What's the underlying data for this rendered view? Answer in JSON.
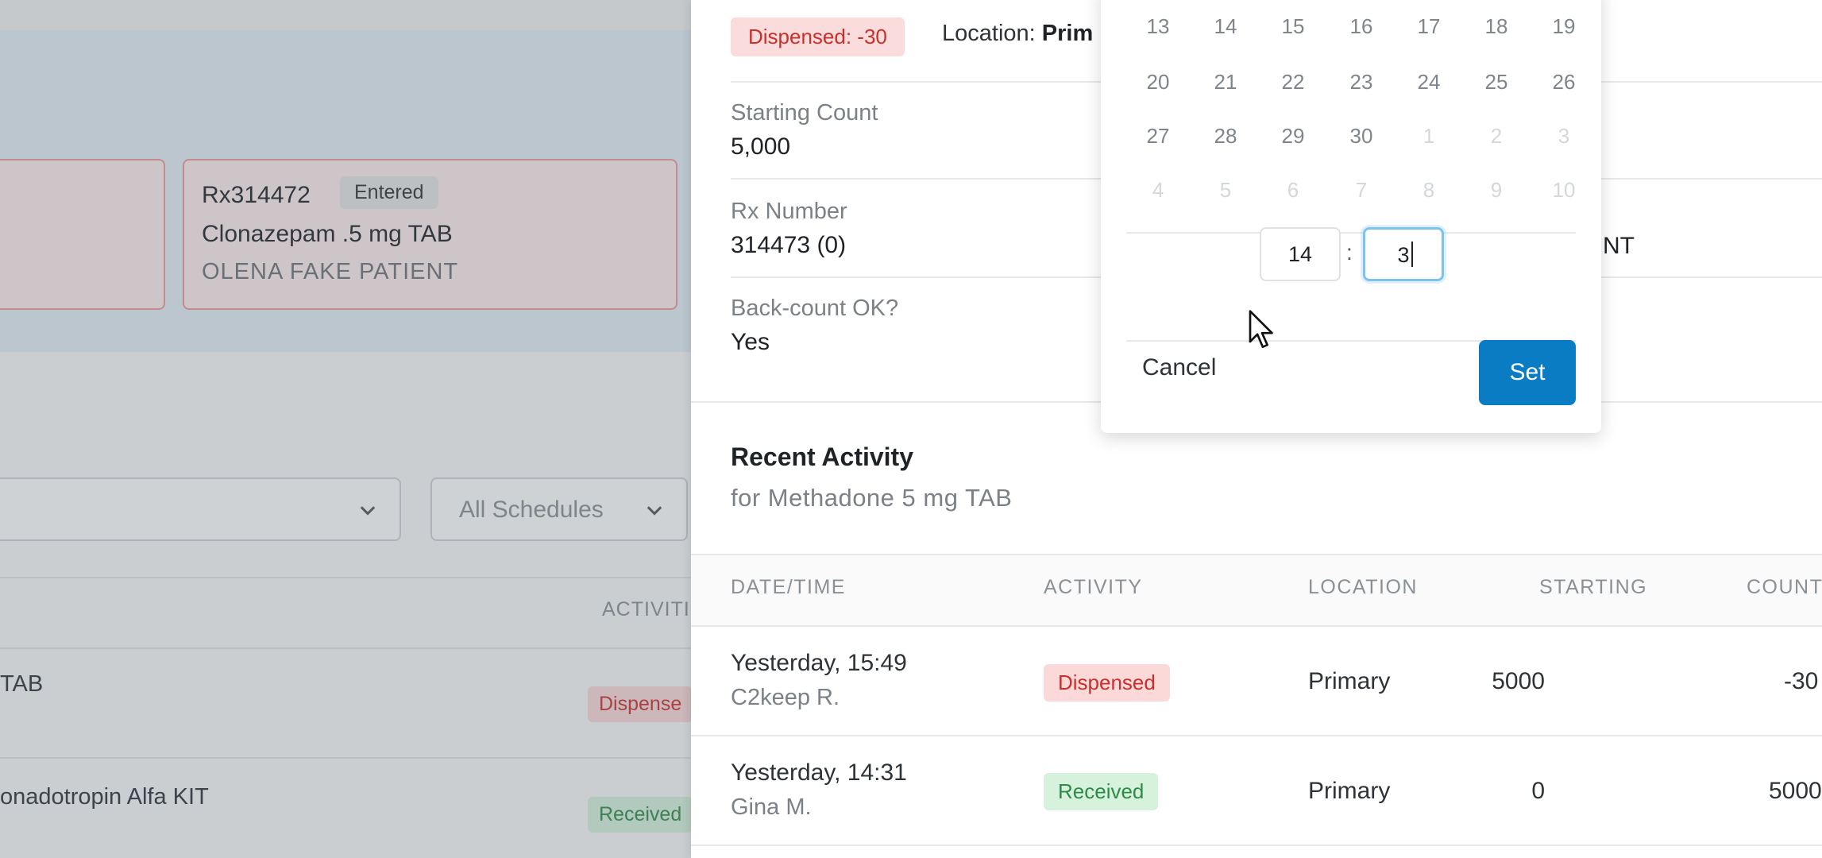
{
  "background": {
    "cards": [
      {
        "rx_number": "",
        "status": "",
        "drug": "",
        "patient": ""
      },
      {
        "rx_number": "Rx314472",
        "status": "Entered",
        "drug": "Clonazepam .5 mg TAB",
        "patient": "OLENA FAKE PATIENT"
      }
    ],
    "filters": {
      "left_select": "",
      "schedules_select": "All Schedules",
      "chevron_icon": "chevron-down-icon"
    },
    "table": {
      "activity_header": "ACTIVITI",
      "rows": [
        {
          "drug": "TAB",
          "activity": "Dispense"
        },
        {
          "drug": "onadotropin Alfa KIT",
          "activity": "Received"
        }
      ]
    }
  },
  "drawer": {
    "dispensed_chip": "Dispensed: -30",
    "location_label": "Location:",
    "location_value": "Prim",
    "fields": {
      "starting_count_label": "Starting Count",
      "starting_count_value": "5,000",
      "rx_number_label": "Rx Number",
      "rx_number_value": "314473 (0)",
      "patient_tail": "NT",
      "backcount_label": "Back-count OK?",
      "backcount_value": "Yes"
    },
    "recent_activity": {
      "title": "Recent Activity",
      "subtitle": "for Methadone 5 mg TAB",
      "columns": [
        "DATE/TIME",
        "ACTIVITY",
        "LOCATION",
        "STARTING",
        "COUNT"
      ],
      "rows": [
        {
          "datetime": "Yesterday, 15:49",
          "user": "C2keep R.",
          "activity": "Dispensed",
          "location": "Primary",
          "starting": "5000",
          "count": "-30"
        },
        {
          "datetime": "Yesterday, 14:31",
          "user": "Gina M.",
          "activity": "Received",
          "location": "Primary",
          "starting": "0",
          "count": "5000"
        }
      ]
    }
  },
  "picker": {
    "weeks": [
      [
        {
          "d": "13",
          "m": false
        },
        {
          "d": "14",
          "m": false
        },
        {
          "d": "15",
          "m": false
        },
        {
          "d": "16",
          "m": false
        },
        {
          "d": "17",
          "m": false
        },
        {
          "d": "18",
          "m": false
        },
        {
          "d": "19",
          "m": false
        }
      ],
      [
        {
          "d": "20",
          "m": false
        },
        {
          "d": "21",
          "m": false
        },
        {
          "d": "22",
          "m": false
        },
        {
          "d": "23",
          "m": false
        },
        {
          "d": "24",
          "m": false
        },
        {
          "d": "25",
          "m": false
        },
        {
          "d": "26",
          "m": false
        }
      ],
      [
        {
          "d": "27",
          "m": false
        },
        {
          "d": "28",
          "m": false
        },
        {
          "d": "29",
          "m": false
        },
        {
          "d": "30",
          "m": false
        },
        {
          "d": "1",
          "m": true
        },
        {
          "d": "2",
          "m": true
        },
        {
          "d": "3",
          "m": true
        }
      ],
      [
        {
          "d": "4",
          "m": true
        },
        {
          "d": "5",
          "m": true
        },
        {
          "d": "6",
          "m": true
        },
        {
          "d": "7",
          "m": true
        },
        {
          "d": "8",
          "m": true
        },
        {
          "d": "9",
          "m": true
        },
        {
          "d": "10",
          "m": true
        }
      ]
    ],
    "hour": "14",
    "separator": ":",
    "minute": "3",
    "cancel_label": "Cancel",
    "set_label": "Set"
  },
  "colors": {
    "accent": "#0a7cc4",
    "dispensed_badge": "#fbd9d9",
    "received_badge": "#d6f2dd",
    "focus_ring": "#7cc3ef"
  }
}
